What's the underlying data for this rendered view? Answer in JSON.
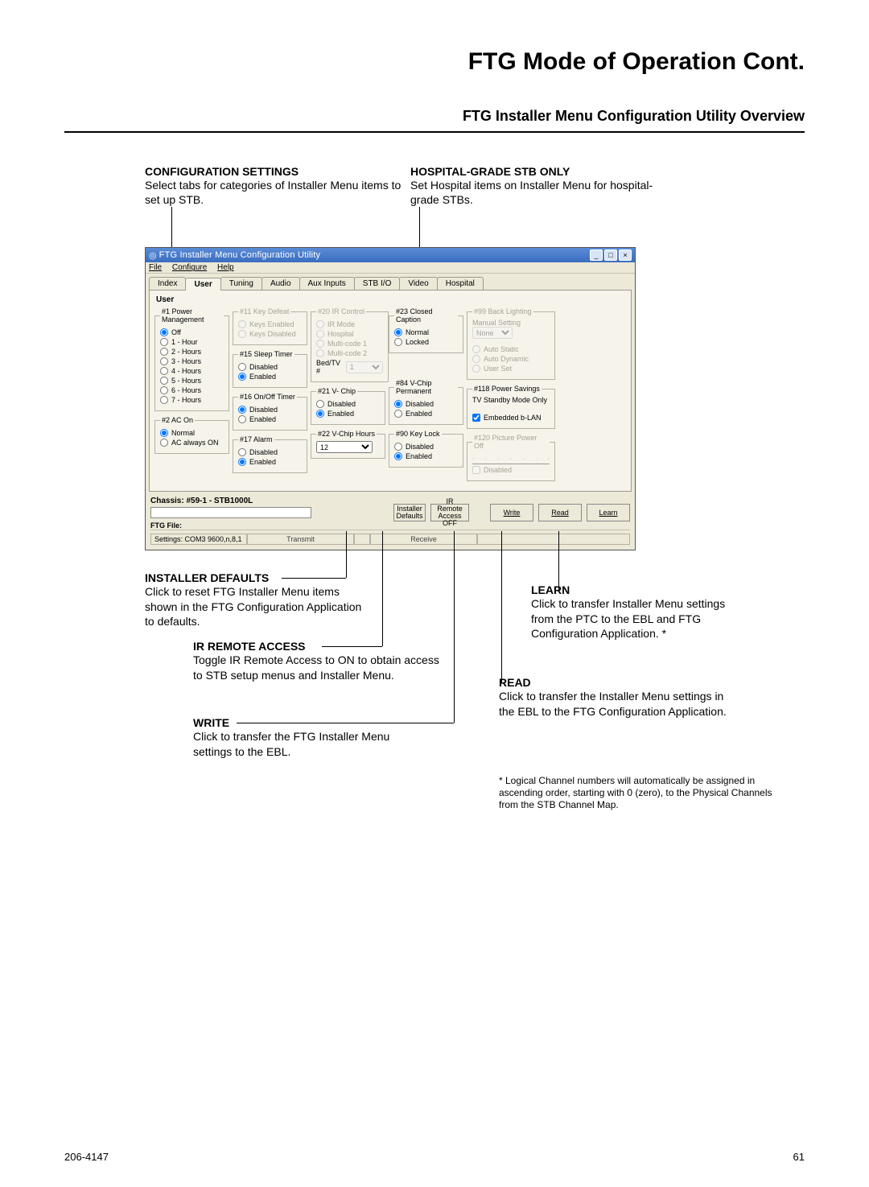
{
  "doc": {
    "title": "FTG Mode of Operation Cont.",
    "subtitle": "FTG Installer Menu Configuration Utility Overview",
    "footer_left": "206-4147",
    "footer_right": "61"
  },
  "ann_top": [
    {
      "hdg": "CONFIGURATION SETTINGS",
      "txt": "Select tabs for categories of Installer Menu items to set up STB."
    },
    {
      "hdg": "HOSPITAL-GRADE STB ONLY",
      "txt": "Set Hospital items on Installer Menu for hospital-grade STBs."
    }
  ],
  "win": {
    "title": "FTG Installer Menu Configuration Utility",
    "menu": [
      "File",
      "Configure",
      "Help"
    ],
    "tabs": [
      "Index",
      "User",
      "Tuning",
      "Audio",
      "Aux Inputs",
      "STB I/O",
      "Video",
      "Hospital"
    ],
    "active_tab": "User",
    "section_label": "User",
    "group1": {
      "legend": "#1 Power Management",
      "options": [
        "Off",
        "1 - Hour",
        "2 - Hours",
        "3 - Hours",
        "4 - Hours",
        "5 - Hours",
        "6 - Hours",
        "7 - Hours"
      ],
      "selected": "Off"
    },
    "group2": {
      "legend": "#2 AC On",
      "options": [
        "Normal",
        "AC always ON"
      ],
      "selected": "Normal"
    },
    "group11": {
      "legend": "#11 Key Defeat",
      "options": [
        "Keys Enabled",
        "Keys Disabled"
      ]
    },
    "group15": {
      "legend": "#15 Sleep Timer",
      "options": [
        "Disabled",
        "Enabled"
      ],
      "selected": "Enabled"
    },
    "group16": {
      "legend": "#16 On/Off Timer",
      "options": [
        "Disabled",
        "Enabled"
      ],
      "selected": "Disabled"
    },
    "group17": {
      "legend": "#17 Alarm",
      "options": [
        "Disabled",
        "Enabled"
      ],
      "selected": "Enabled"
    },
    "group20": {
      "legend": "#20 IR Control",
      "options": [
        "IR Mode",
        "Hospital",
        "Multi-code 1",
        "Multi-code 2"
      ],
      "bed_label": "Bed/TV #",
      "bed_value": "1"
    },
    "group21": {
      "legend": "#21 V- Chip",
      "options": [
        "Disabled",
        "Enabled"
      ],
      "selected": "Enabled"
    },
    "group22": {
      "legend": "#22 V-Chip Hours",
      "value": "12"
    },
    "group23": {
      "legend": "#23 Closed Caption",
      "options": [
        "Normal",
        "Locked"
      ],
      "selected": "Normal"
    },
    "group84": {
      "legend": "#84 V-Chip Permanent",
      "options": [
        "Disabled",
        "Enabled"
      ],
      "selected": "Disabled"
    },
    "group90": {
      "legend": "#90 Key Lock",
      "options": [
        "Disabled",
        "Enabled"
      ],
      "selected": "Enabled"
    },
    "group99": {
      "legend": "#99 Back Lighting",
      "manual": "Manual Setting",
      "dropdown": "None",
      "options": [
        "Auto Static",
        "Auto Dynamic",
        "User Set"
      ]
    },
    "group118": {
      "legend": "#118 Power Savings",
      "sub": "TV Standby Mode Only",
      "chk": "Embedded b-LAN"
    },
    "group120": {
      "legend": "#120 Picture Power Off",
      "chk": "Disabled"
    },
    "chassis": "Chassis: #59-1 - STB1000L",
    "ftg_file_label": "FTG File:",
    "btn_installer_defaults": "Installer\nDefaults",
    "btn_ir_remote": "IR Remote\nAccess OFF",
    "btn_write": "Write",
    "btn_read": "Read",
    "btn_learn": "Learn",
    "settings": "Settings: COM3 9600,n,8,1",
    "transmit": "Transmit",
    "receive": "Receive"
  },
  "ann_bottom": {
    "installer_defaults": {
      "hdg": "INSTALLER DEFAULTS",
      "txt": "Click to reset FTG Installer Menu items shown in the FTG Configuration Application to defaults."
    },
    "ir": {
      "hdg": "IR REMOTE ACCESS",
      "txt": "Toggle IR Remote Access to ON to obtain access to STB setup menus and Installer Menu."
    },
    "write": {
      "hdg": "WRITE",
      "txt": "Click to transfer the FTG Installer Menu settings to the EBL."
    },
    "learn": {
      "hdg": "LEARN",
      "txt": "Click to transfer Installer Menu settings from the PTC to the EBL and FTG Configuration Application. *"
    },
    "read": {
      "hdg": "READ",
      "txt": "Click to transfer the Installer Menu settings in the EBL to the FTG Configuration Application."
    },
    "footnote": "* Logical Channel numbers will automatically be assigned in ascending order, starting with 0 (zero), to the Physical Channels from the STB Channel Map."
  }
}
